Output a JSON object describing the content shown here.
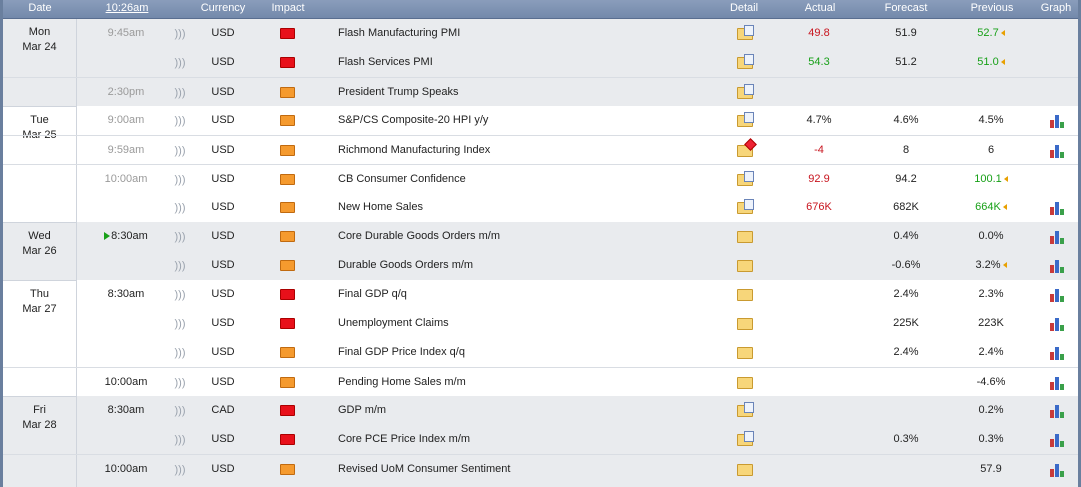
{
  "header": {
    "date": "Date",
    "time": "10:26am",
    "currency": "Currency",
    "impact": "Impact",
    "detail": "Detail",
    "actual": "Actual",
    "forecast": "Forecast",
    "previous": "Previous",
    "graph": "Graph"
  },
  "days": [
    {
      "dow": "Mon",
      "md": "Mar 24"
    },
    {
      "dow": "Tue",
      "md": "Mar 25"
    },
    {
      "dow": "Wed",
      "md": "Mar 26"
    },
    {
      "dow": "Thu",
      "md": "Mar 27"
    },
    {
      "dow": "Fri",
      "md": "Mar 28"
    }
  ],
  "rows": [
    {
      "time": "9:45am",
      "currency": "USD",
      "impact": "high",
      "event": "Flash Manufacturing PMI",
      "actual": "49.8",
      "forecast": "51.9",
      "previous": "52.7"
    },
    {
      "time": "",
      "currency": "USD",
      "impact": "high",
      "event": "Flash Services PMI",
      "actual": "54.3",
      "forecast": "51.2",
      "previous": "51.0"
    },
    {
      "time": "2:30pm",
      "currency": "USD",
      "impact": "med",
      "event": "President Trump Speaks",
      "actual": "",
      "forecast": "",
      "previous": ""
    },
    {
      "time": "9:00am",
      "currency": "USD",
      "impact": "med",
      "event": "S&P/CS Composite-20 HPI y/y",
      "actual": "4.7%",
      "forecast": "4.6%",
      "previous": "4.5%"
    },
    {
      "time": "9:59am",
      "currency": "USD",
      "impact": "med",
      "event": "Richmond Manufacturing Index",
      "actual": "-4",
      "forecast": "8",
      "previous": "6"
    },
    {
      "time": "10:00am",
      "currency": "USD",
      "impact": "med",
      "event": "CB Consumer Confidence",
      "actual": "92.9",
      "forecast": "94.2",
      "previous": "100.1"
    },
    {
      "time": "",
      "currency": "USD",
      "impact": "med",
      "event": "New Home Sales",
      "actual": "676K",
      "forecast": "682K",
      "previous": "664K"
    },
    {
      "time": "8:30am",
      "currency": "USD",
      "impact": "med",
      "event": "Core Durable Goods Orders m/m",
      "actual": "",
      "forecast": "0.4%",
      "previous": "0.0%"
    },
    {
      "time": "",
      "currency": "USD",
      "impact": "med",
      "event": "Durable Goods Orders m/m",
      "actual": "",
      "forecast": "-0.6%",
      "previous": "3.2%"
    },
    {
      "time": "8:30am",
      "currency": "USD",
      "impact": "high",
      "event": "Final GDP q/q",
      "actual": "",
      "forecast": "2.4%",
      "previous": "2.3%"
    },
    {
      "time": "",
      "currency": "USD",
      "impact": "high",
      "event": "Unemployment Claims",
      "actual": "",
      "forecast": "225K",
      "previous": "223K"
    },
    {
      "time": "",
      "currency": "USD",
      "impact": "med",
      "event": "Final GDP Price Index q/q",
      "actual": "",
      "forecast": "2.4%",
      "previous": "2.4%"
    },
    {
      "time": "10:00am",
      "currency": "USD",
      "impact": "med",
      "event": "Pending Home Sales m/m",
      "actual": "",
      "forecast": "",
      "previous": "-4.6%"
    },
    {
      "time": "8:30am",
      "currency": "CAD",
      "impact": "high",
      "event": "GDP m/m",
      "actual": "",
      "forecast": "",
      "previous": "0.2%"
    },
    {
      "time": "",
      "currency": "USD",
      "impact": "high",
      "event": "Core PCE Price Index m/m",
      "actual": "",
      "forecast": "0.3%",
      "previous": "0.3%"
    },
    {
      "time": "10:00am",
      "currency": "USD",
      "impact": "med",
      "event": "Revised UoM Consumer Sentiment",
      "actual": "",
      "forecast": "",
      "previous": "57.9"
    }
  ],
  "colors": {
    "header_bg": "#7a8fb0",
    "row_white": "#ffffff",
    "row_shade": "#e9ebee",
    "actual_worse": "#c8141e",
    "actual_better": "#18a018",
    "impact_high": "#e8101a",
    "impact_medium": "#f59a2e"
  },
  "icons": {
    "speaker": "speaker-icon",
    "detail": "folder-icon",
    "graph": "bar-chart-icon",
    "revision": "revision-arrow-icon",
    "upnext": "up-next-triangle-icon"
  }
}
